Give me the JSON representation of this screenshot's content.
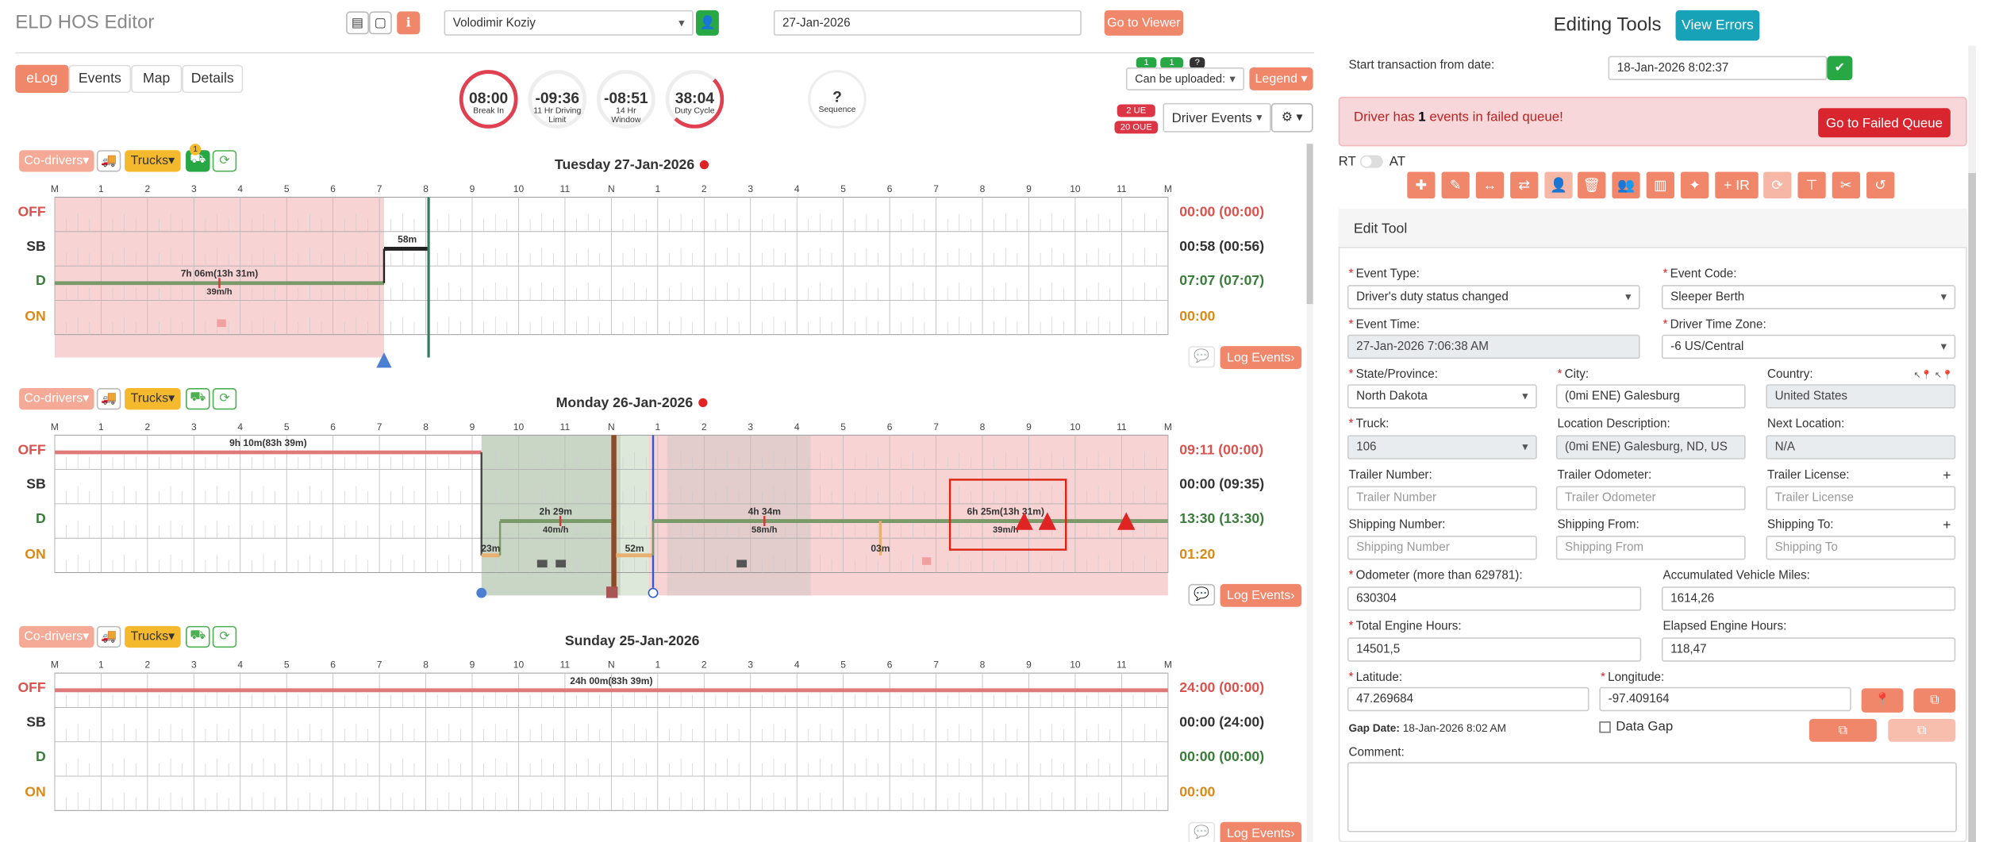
{
  "app": {
    "title": "ELD HOS Editor"
  },
  "header": {
    "driver": "Volodimir Koziy",
    "date": "27-Jan-2026",
    "go_viewer": "Go to Viewer",
    "upload_select": "Can be uploaded:",
    "upload_badges": [
      "1",
      "1",
      "?"
    ],
    "legend": "Legend",
    "ue_badge": "2 UE",
    "oue_badge": "20 OUE",
    "driver_events": "Driver Events"
  },
  "tabs": [
    "eLog",
    "Events",
    "Map",
    "Details"
  ],
  "clocks": [
    {
      "value": "08:00",
      "label": "Break In",
      "progress": 1.0
    },
    {
      "value": "-09:36",
      "label": "11 Hr Driving Limit",
      "progress": 0.0
    },
    {
      "value": "-08:51",
      "label": "14 Hr Window",
      "progress": 0.0
    },
    {
      "value": "38:04",
      "label": "Duty Cycle",
      "progress": 0.5
    },
    {
      "value": "?",
      "label": "Sequence",
      "progress": 0.0
    }
  ],
  "grid": {
    "hour_ticks": [
      "M",
      "1",
      "2",
      "3",
      "4",
      "5",
      "6",
      "7",
      "8",
      "9",
      "10",
      "11",
      "N",
      "1",
      "2",
      "3",
      "4",
      "5",
      "6",
      "7",
      "8",
      "9",
      "10",
      "11",
      "M"
    ],
    "status_rows": [
      "OFF",
      "SB",
      "D",
      "ON"
    ],
    "co_drivers": "Co-drivers",
    "trucks": "Trucks",
    "log_events": "Log Events"
  },
  "days": [
    {
      "title": "Tuesday 27-Jan-2026",
      "totals": [
        "00:00 (00:00)",
        "00:58 (00:56)",
        "07:07 (07:07)",
        "00:00"
      ],
      "notes": {
        "drive": "7h 06m(13h 31m)",
        "speed": "39m/h",
        "sb": "58m"
      },
      "badge": "1"
    },
    {
      "title": "Monday 26-Jan-2026",
      "totals": [
        "09:11 (00:00)",
        "00:00 (09:35)",
        "13:30 (13:30)",
        "01:20"
      ],
      "notes": {
        "off": "9h 10m(83h 39m)",
        "d1": "2h 29m",
        "s1": "40m/h",
        "on1": "23m",
        "on2": "52m",
        "d2": "4h 34m",
        "s2": "58m/h",
        "on3": "03m",
        "d3": "6h 25m(13h 31m)",
        "s3": "39m/h"
      }
    },
    {
      "title": "Sunday 25-Jan-2026",
      "totals": [
        "24:00 (00:00)",
        "00:00 (24:00)",
        "00:00 (00:00)",
        "00:00"
      ],
      "notes": {
        "off": "24h 00m(83h 39m)"
      }
    }
  ],
  "panel": {
    "title": "Editing Tools",
    "view_errors": "View Errors",
    "start_label": "Start transaction from date:",
    "start_value": "18-Jan-2026 8:02:37",
    "failed_pre": "Driver has ",
    "failed_count": "1",
    "failed_post": " events in failed queue!",
    "failed_btn": "Go to Failed Queue",
    "rt": "RT",
    "at": "AT",
    "ir_label": "+ IR",
    "edit_tool": "Edit Tool",
    "fields": {
      "event_type": {
        "label": "Event Type:",
        "value": "Driver's duty status changed"
      },
      "event_code": {
        "label": "Event Code:",
        "value": "Sleeper Berth"
      },
      "event_time": {
        "label": "Event Time:",
        "value": "27-Jan-2026 7:06:38 AM"
      },
      "tz": {
        "label": "Driver Time Zone:",
        "value": "-6 US/Central"
      },
      "state": {
        "label": "State/Province:",
        "value": "North Dakota"
      },
      "city": {
        "label": "City:",
        "value": "(0mi ENE) Galesburg"
      },
      "country": {
        "label": "Country:",
        "value": "United States"
      },
      "truck": {
        "label": "Truck:",
        "value": "106"
      },
      "loc_desc": {
        "label": "Location Description:",
        "value": "(0mi ENE) Galesburg, ND, US"
      },
      "next_loc": {
        "label": "Next Location:",
        "value": "N/A"
      },
      "trailer_num": {
        "label": "Trailer Number:",
        "placeholder": "Trailer Number"
      },
      "trailer_odo": {
        "label": "Trailer Odometer:",
        "placeholder": "Trailer Odometer"
      },
      "trailer_lic": {
        "label": "Trailer License:",
        "placeholder": "Trailer License"
      },
      "ship_num": {
        "label": "Shipping Number:",
        "placeholder": "Shipping Number"
      },
      "ship_from": {
        "label": "Shipping From:",
        "placeholder": "Shipping From"
      },
      "ship_to": {
        "label": "Shipping To:",
        "placeholder": "Shipping To"
      },
      "odometer": {
        "label": "Odometer (more than 629781):",
        "value": "630304"
      },
      "acc_miles": {
        "label": "Accumulated Vehicle Miles:",
        "value": "1614,26"
      },
      "eng_hours": {
        "label": "Total Engine Hours:",
        "value": "14501,5"
      },
      "elapsed": {
        "label": "Elapsed Engine Hours:",
        "value": "118,47"
      },
      "lat": {
        "label": "Latitude:",
        "value": "47.269684"
      },
      "lon": {
        "label": "Longitude:",
        "value": "-97.409164"
      },
      "gap_label": "Gap Date:",
      "gap_value": "18-Jan-2026 8:02 AM",
      "data_gap": "Data Gap",
      "comment": "Comment:"
    }
  },
  "colors": {
    "accent": "#f0876b",
    "off_shade": "#f7d0d0",
    "drive": "#7a9a6a",
    "primary": "#17a2b8",
    "danger": "#dc3545"
  }
}
